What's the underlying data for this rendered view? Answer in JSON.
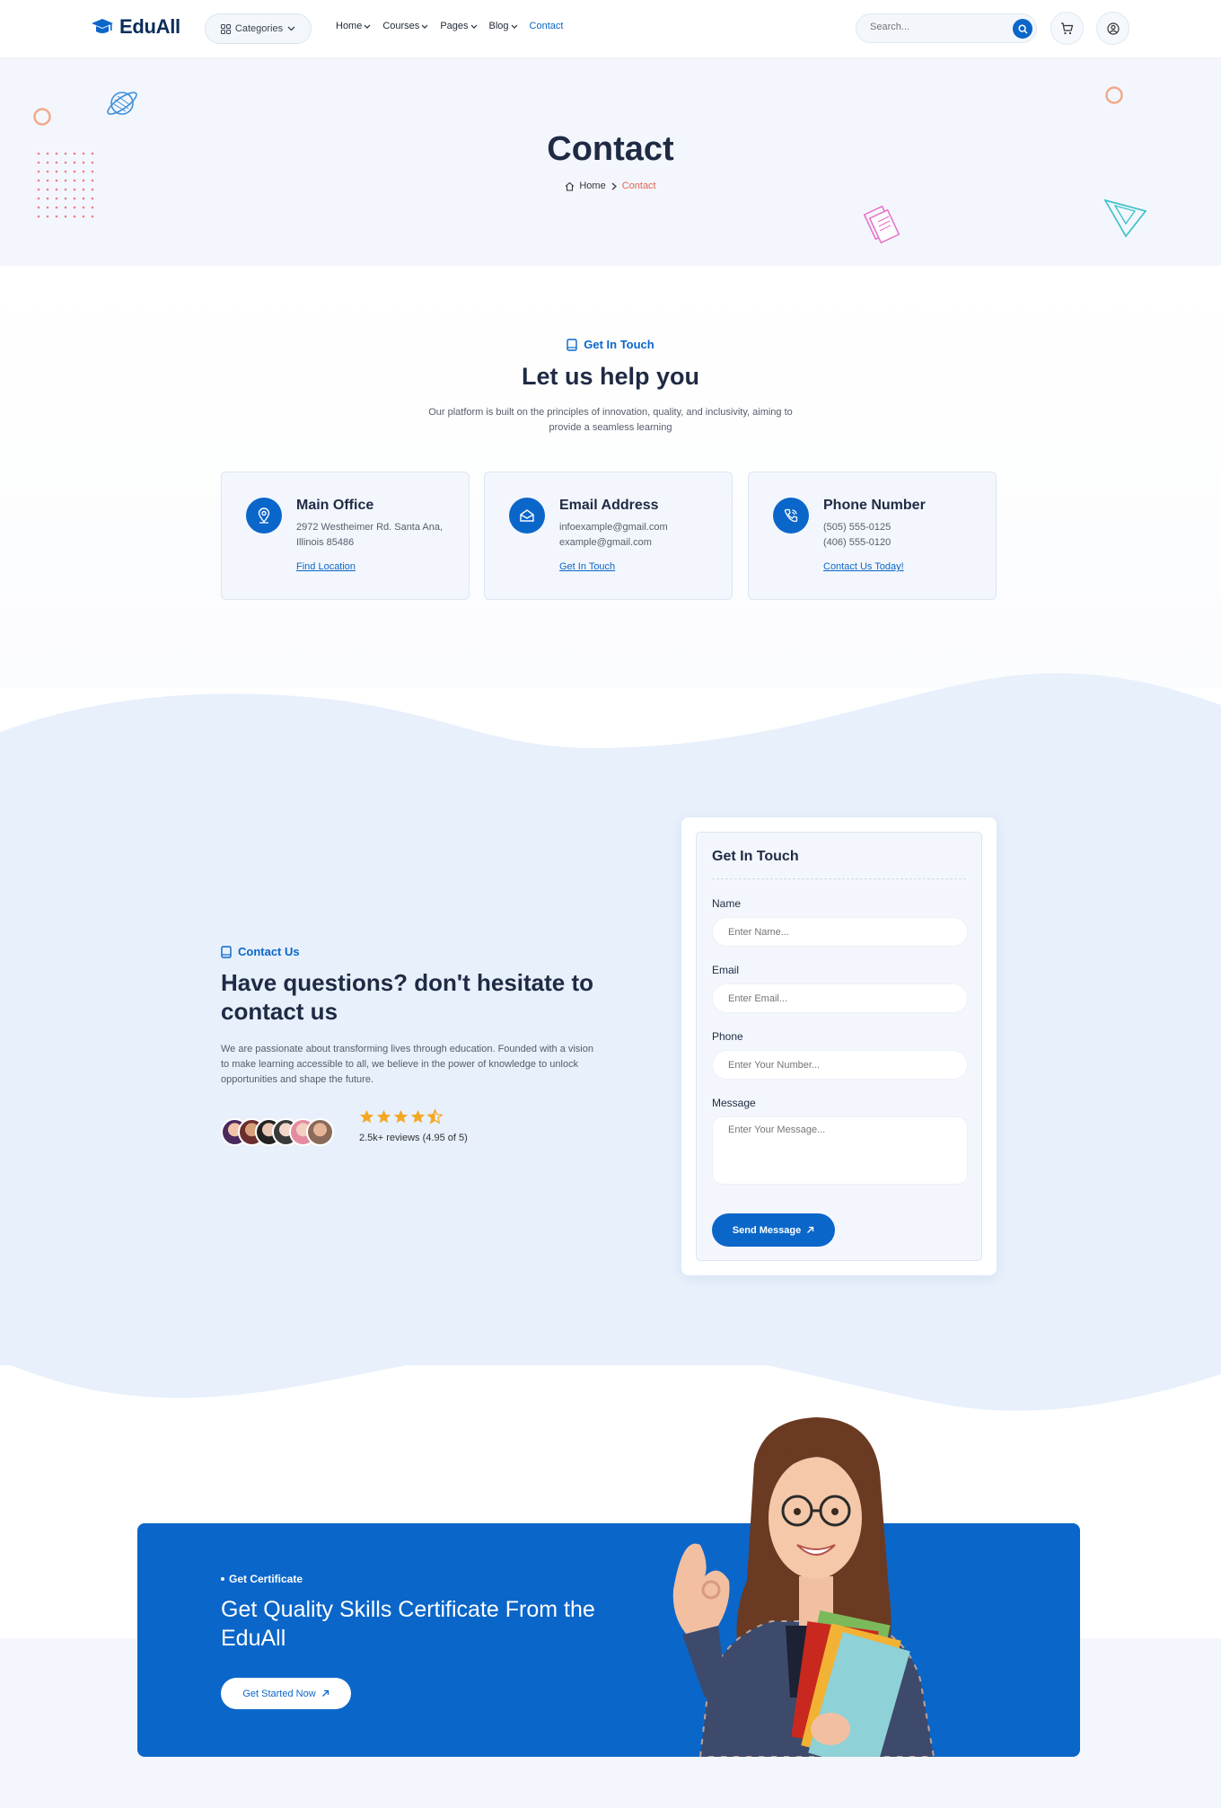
{
  "header": {
    "logo": "EduAll",
    "categories_label": "Categories",
    "nav": [
      {
        "label": "Home",
        "dropdown": true
      },
      {
        "label": "Courses",
        "dropdown": true
      },
      {
        "label": "Pages",
        "dropdown": true
      },
      {
        "label": "Blog",
        "dropdown": true
      },
      {
        "label": "Contact",
        "dropdown": false
      }
    ],
    "search_placeholder": "Search..."
  },
  "hero": {
    "title": "Contact",
    "breadcrumb_home": "Home",
    "breadcrumb_current": "Contact"
  },
  "help": {
    "tag": "Get In Touch",
    "title": "Let us help you",
    "lead": "Our platform is built on the principles of innovation, quality, and inclusivity, aiming to provide a seamless learning",
    "cards": [
      {
        "icon": "map-pin-icon",
        "title": "Main Office",
        "line1": "2972 Westheimer Rd. Santa Ana,",
        "line2": "Illinois 85486",
        "link": "Find Location"
      },
      {
        "icon": "envelope-icon",
        "title": "Email Address",
        "line1": "infoexample@gmail.com",
        "line2": "example@gmail.com",
        "link": "Get In Touch"
      },
      {
        "icon": "phone-icon",
        "title": "Phone Number",
        "line1": "(505) 555-0125",
        "line2": "(406) 555-0120",
        "link": "Contact Us Today!"
      }
    ]
  },
  "contact": {
    "tag": "Contact Us",
    "title": "Have questions? don't hesitate to contact us",
    "text": "We are passionate about transforming lives through education. Founded with a vision to make learning accessible to all, we believe in the power of knowledge to unlock opportunities and shape the future.",
    "rating": 4.5,
    "reviews": "2.5k+ reviews (4.95 of 5)"
  },
  "form": {
    "title": "Get In Touch",
    "name_label": "Name",
    "name_placeholder": "Enter Name...",
    "email_label": "Email",
    "email_placeholder": "Enter Email...",
    "phone_label": "Phone",
    "phone_placeholder": "Enter Your Number...",
    "message_label": "Message",
    "message_placeholder": "Enter Your Message...",
    "submit": "Send Message"
  },
  "certificate": {
    "tag": "Get Certificate",
    "title": "Get Quality Skills Certificate From the EduAll",
    "button": "Get Started Now"
  },
  "colors": {
    "primary": "#0b66c9",
    "heading": "#1f2a44",
    "accent_orange": "#e5624d",
    "star": "#f5a623",
    "section_bg": "#e7f0fb"
  }
}
